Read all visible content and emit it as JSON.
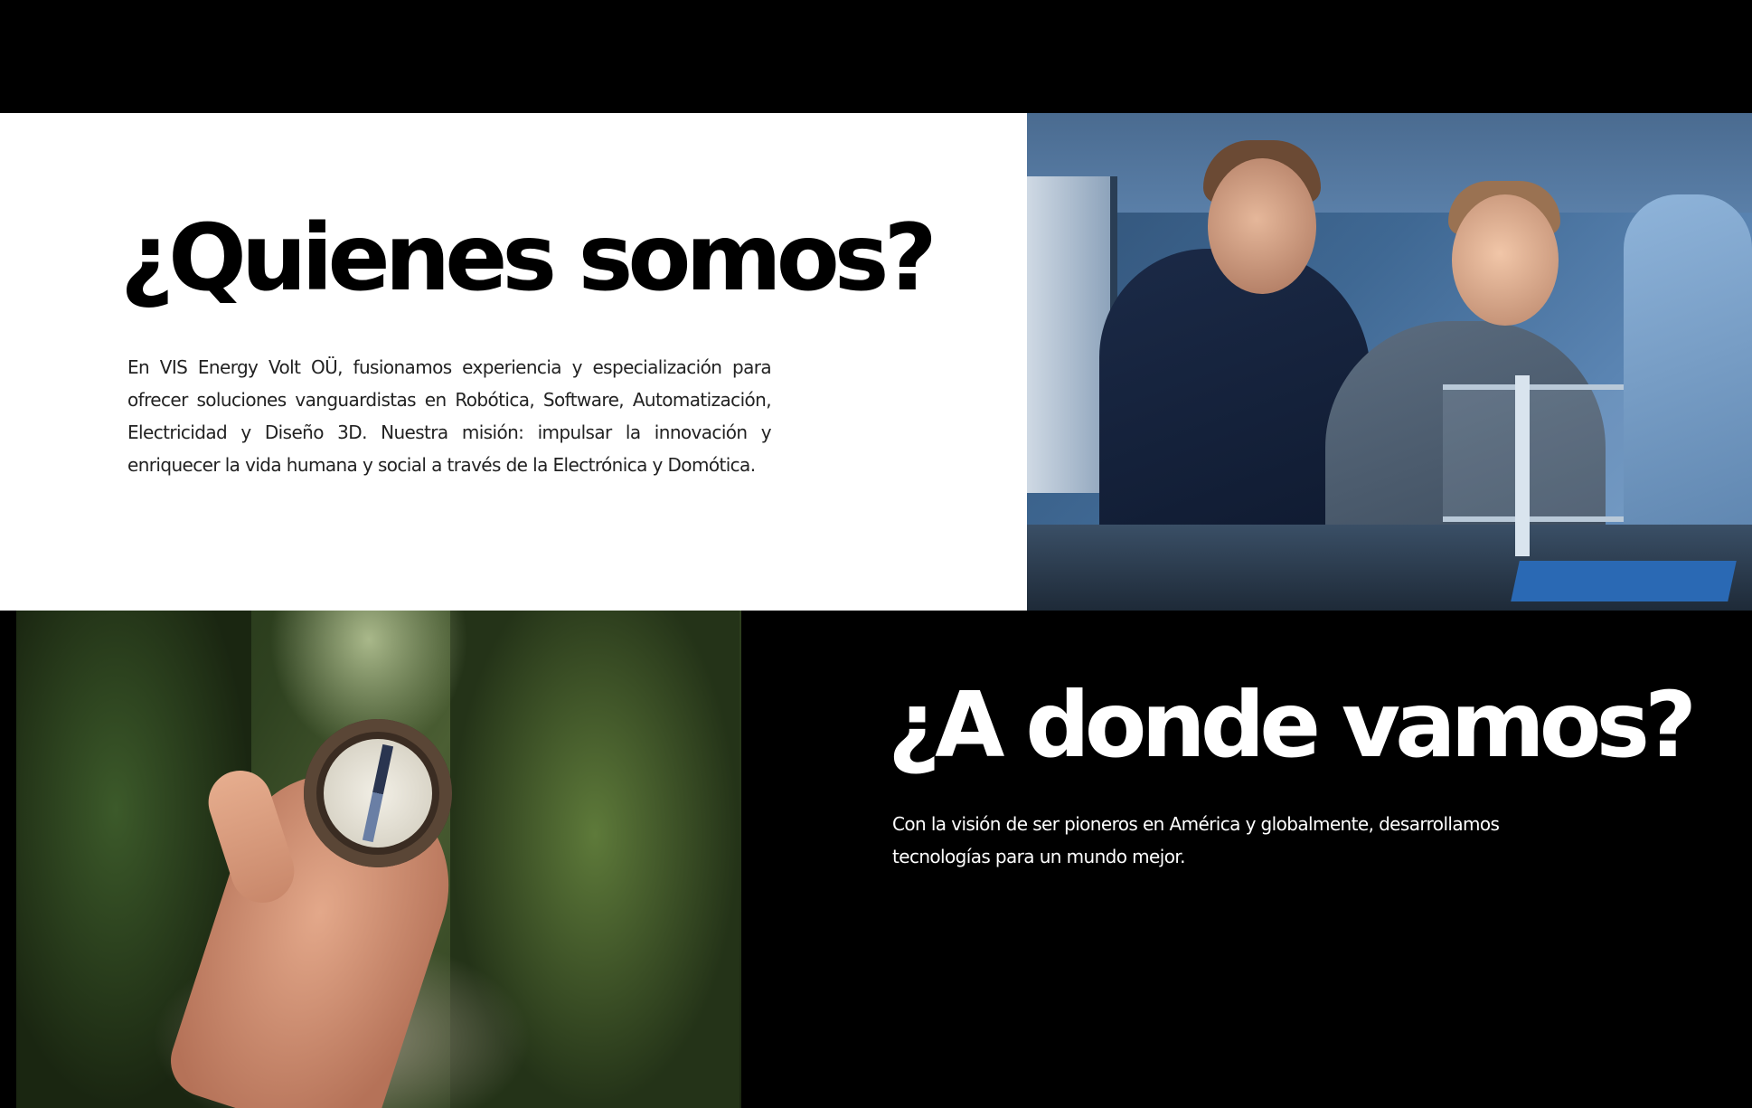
{
  "about": {
    "title": "¿Quienes somos?",
    "text": "En VIS Energy Volt OÜ, fusionamos experiencia y especialización para ofrecer soluciones vanguardistas en Robótica, Software, Automatización, Electricidad y Diseño 3D. Nuestra misión: impulsar la innovación y enriquecer la vida humana y social a través de la Electrónica y Domótica.",
    "image": "engineers-working-on-electronics-photo"
  },
  "vision": {
    "title": "¿A donde vamos?",
    "text": "Con la visión de ser pioneros en América y globalmente, desarrollamos tecnologías para un mundo mejor.",
    "image": "hand-holding-compass-in-forest-photo"
  },
  "colors": {
    "background": "#000000",
    "panel": "#ffffff",
    "text_dark": "#000000",
    "text_light": "#ffffff"
  }
}
